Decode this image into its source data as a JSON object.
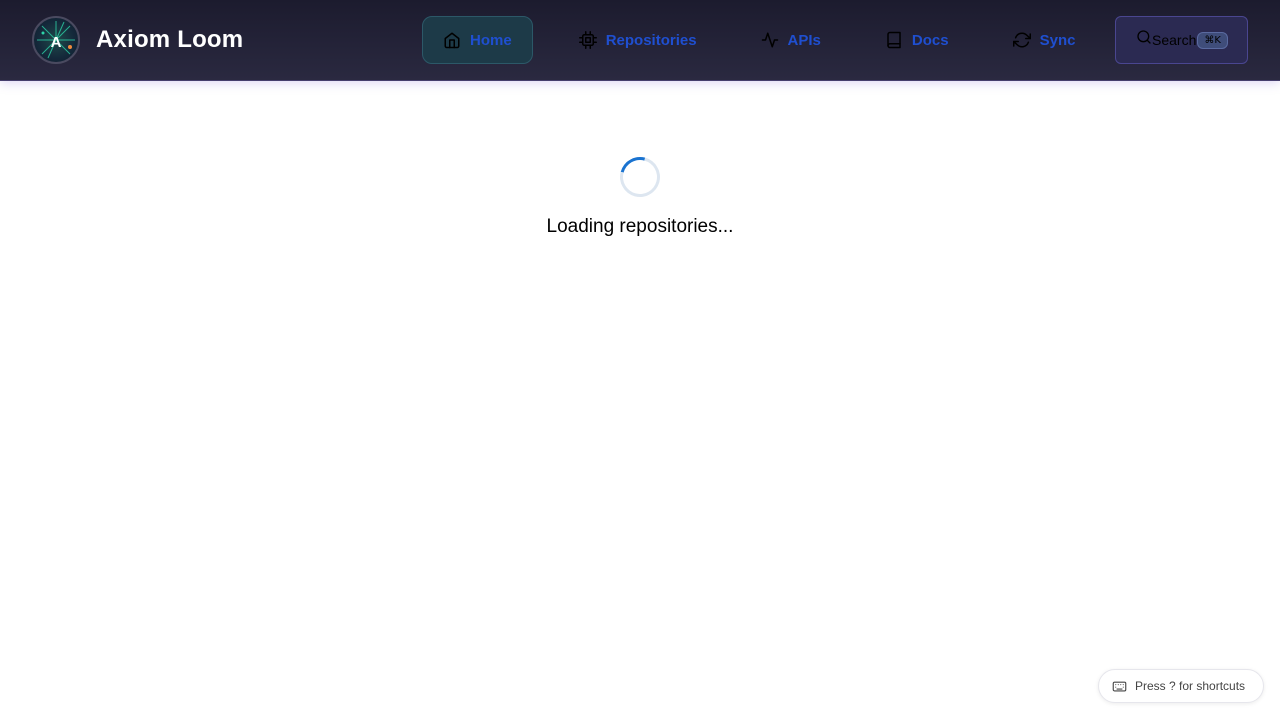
{
  "app": {
    "name": "Axiom Loom"
  },
  "nav": {
    "items": [
      {
        "label": "Home",
        "icon": "home-icon",
        "active": true
      },
      {
        "label": "Repositories",
        "icon": "cpu-icon",
        "active": false
      },
      {
        "label": "APIs",
        "icon": "activity-icon",
        "active": false
      },
      {
        "label": "Docs",
        "icon": "book-icon",
        "active": false
      },
      {
        "label": "Sync",
        "icon": "refresh-icon",
        "active": false
      }
    ]
  },
  "search": {
    "label": "Search",
    "shortcut": "⌘K",
    "icon": "search-icon"
  },
  "main": {
    "loading_text": "Loading repositories..."
  },
  "shortcut_hint": {
    "label": "Press ? for shortcuts",
    "icon": "keyboard-icon"
  },
  "colors": {
    "nav_link": "#1f4fd0",
    "header_bg": "#1c1b2e",
    "spinner_accent": "#1a73d0"
  }
}
